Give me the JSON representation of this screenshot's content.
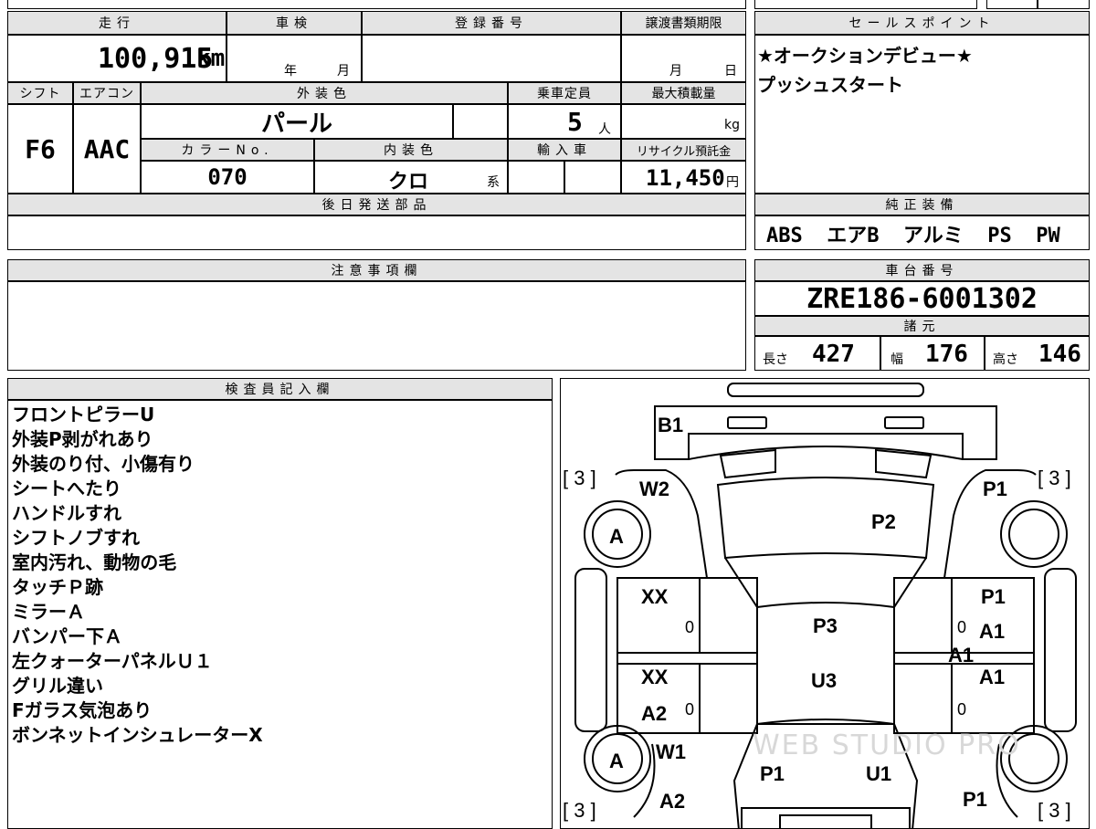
{
  "mileage": {
    "label": "走行",
    "value": "100,915",
    "unit": "km"
  },
  "inspection": {
    "label": "車検",
    "year_unit": "年",
    "month_unit": "月"
  },
  "registration": {
    "label": "登録番号"
  },
  "transfer_deadline": {
    "label": "譲渡書類期限",
    "month_unit": "月",
    "day_unit": "日"
  },
  "shift": {
    "label": "シフト",
    "value": "F6"
  },
  "aircon": {
    "label": "エアコン",
    "value": "AAC"
  },
  "exterior_color": {
    "label": "外装色",
    "value": "パール"
  },
  "capacity": {
    "label": "乗車定員",
    "value": "5",
    "unit": "人"
  },
  "max_load": {
    "label": "最大積載量",
    "unit": "kg"
  },
  "color_no": {
    "label": "カラーNo.",
    "value": "070"
  },
  "interior_color": {
    "label": "内装色",
    "value": "クロ",
    "suffix": "系"
  },
  "import": {
    "label": "輸入車"
  },
  "recycle_fee": {
    "label": "リサイクル預託金",
    "value": "11,450",
    "unit": "円"
  },
  "later_parts": {
    "label": "後日発送部品"
  },
  "sales_points": {
    "label": "セールスポイント",
    "lines": [
      "★オークションデビュー★",
      "プッシュスタート"
    ]
  },
  "equipment": {
    "label": "純正装備",
    "value": "ABS  エアB  アルミ  PS  PW"
  },
  "caution": {
    "label": "注意事項欄"
  },
  "chassis": {
    "label": "車台番号",
    "value": "ZRE186-6001302"
  },
  "specs": {
    "label": "諸元",
    "length": {
      "label": "長さ",
      "value": "427"
    },
    "width": {
      "label": "幅",
      "value": "176"
    },
    "height": {
      "label": "高さ",
      "value": "146"
    }
  },
  "inspector": {
    "label": "検査員記入欄",
    "notes": [
      "フロントピラーU",
      "外装P剥がれあり",
      "外装のり付、小傷有り",
      "シートへたり",
      "ハンドルすれ",
      "シフトノブすれ",
      "室内汚れ、動物の毛",
      "タッチＰ跡",
      "ミラーＡ",
      "バンパー下Ａ",
      "左クォーターパネルＵ１",
      "グリル違い",
      "Fガラス気泡あり",
      "ボンネットインシュレーターX"
    ]
  },
  "diagram": {
    "marks": {
      "b1": "B1",
      "w2": "W2",
      "p1_rf": "P1",
      "p2": "P2",
      "a_lf": "A",
      "xx_l1": "XX",
      "p1_r": "P1",
      "p3": "P3",
      "a1_r1": "A1",
      "a1_c": "A1",
      "xx_l2": "XX",
      "u3": "U3",
      "a1_r2": "A1",
      "a2_l": "A2",
      "w1": "W1",
      "a_lr": "A",
      "p1_lr": "P1",
      "u1": "U1",
      "a2_b": "A2",
      "p1_rr": "P1"
    },
    "tires": {
      "fl": "[ 3 ]",
      "fr": "[ 3 ]",
      "rl": "[ 3 ]",
      "rr": "[ 3 ]"
    },
    "zeros": [
      "0",
      "0",
      "0",
      "0"
    ],
    "watermark": "WEB STUDIO PRO"
  }
}
